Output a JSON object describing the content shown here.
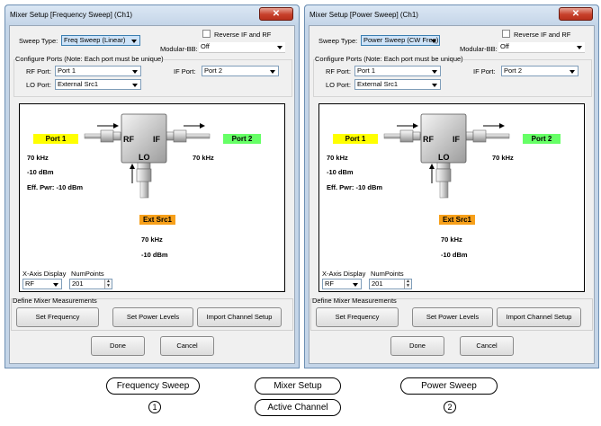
{
  "dialogs": {
    "freq": {
      "title": "Mixer Setup [Frequency Sweep] (Ch1)",
      "close_glyph": "✕",
      "sweep_type_label": "Sweep Type:",
      "sweep_type_value": "Freq Sweep (Linear)",
      "reverse_label": "Reverse IF and RF",
      "modulator_label": "Modular-BB:",
      "modulator_value": "Off",
      "configure_label": "Configure Ports (Note: Each port must be unique)",
      "rf_port_label": "RF Port:",
      "rf_port_value": "Port 1",
      "if_port_label": "IF Port:",
      "if_port_value": "Port 2",
      "lo_port_label": "LO Port:",
      "lo_port_value": "External Src1",
      "diagram": {
        "port1": "Port 1",
        "port2": "Port 2",
        "rf": "RF",
        "if": "IF",
        "lo": "LO",
        "rf_freq": "70 kHz",
        "rf_power": "-10 dBm",
        "eff_power": "Eff. Pwr: -10 dBm",
        "if_freq": "70 kHz",
        "ext_src": "Ext Src1",
        "lo_freq": "70 kHz",
        "lo_power": "-10 dBm"
      },
      "xaxis_label": "X-Axis Display",
      "xaxis_value": "RF",
      "numpoints_label": "NumPoints",
      "numpoints_value": "201",
      "define_label": "Define Mixer Measurements",
      "btn_set_frequency": "Set Frequency",
      "btn_set_power": "Set Power Levels",
      "btn_import": "Import Channel Setup",
      "btn_done": "Done",
      "btn_cancel": "Cancel"
    },
    "power": {
      "title": "Mixer Setup [Power Sweep] (Ch1)",
      "close_glyph": "✕",
      "sweep_type_label": "Sweep Type:",
      "sweep_type_value": "Power Sweep (CW Freq)",
      "reverse_label": "Reverse IF and RF",
      "modulator_label": "Modular-BB:",
      "modulator_value": "Off",
      "configure_label": "Configure Ports (Note: Each port must be unique)",
      "rf_port_label": "RF Port:",
      "rf_port_value": "Port 1",
      "if_port_label": "IF Port:",
      "if_port_value": "Port 2",
      "lo_port_label": "LO Port:",
      "lo_port_value": "External Src1",
      "diagram": {
        "port1": "Port 1",
        "port2": "Port 2",
        "rf": "RF",
        "if": "IF",
        "lo": "LO",
        "rf_freq": "70 kHz",
        "rf_power": "-10 dBm",
        "eff_power": "Eff. Pwr: -10 dBm",
        "if_freq": "70 kHz",
        "ext_src": "Ext Src1",
        "lo_freq": "70 kHz",
        "lo_power": "-10 dBm"
      },
      "xaxis_label": "X-Axis Display",
      "xaxis_value": "RF",
      "numpoints_label": "NumPoints",
      "numpoints_value": "201",
      "define_label": "Define Mixer Measurements",
      "btn_set_frequency": "Set Frequency",
      "btn_set_power": "Set Power Levels",
      "btn_import": "Import Channel Setup",
      "btn_done": "Done",
      "btn_cancel": "Cancel"
    }
  },
  "captions": {
    "frequency_sweep": "Frequency Sweep",
    "mixer_setup": "Mixer Setup",
    "active_channel": "Active Channel",
    "power_sweep": "Power Sweep",
    "num_1": "1",
    "num_2": "2"
  },
  "colors": {
    "port1_tag": "#ffff00",
    "port2_tag": "#66ff66",
    "ext_src_tag": "#f7a01a",
    "title_bar": "#c4d5e8",
    "close_button": "#c7402b"
  },
  "icons": {
    "close": "close-icon",
    "dropdown": "chevron-down-icon",
    "mixer": "mixer-icon",
    "arrow": "arrow-icon"
  }
}
